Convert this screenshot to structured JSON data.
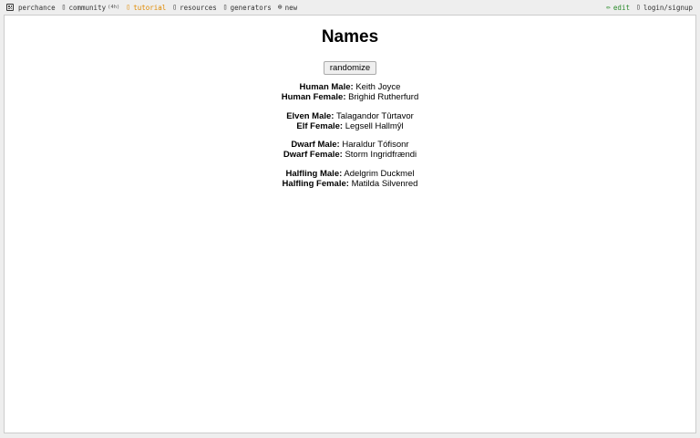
{
  "nav": {
    "brand": "perchance",
    "community": "community",
    "community_count": "(4h)",
    "tutorial": "tutorial",
    "resources": "resources",
    "generators": "generators",
    "new": "new",
    "edit": "edit",
    "login": "login/signup"
  },
  "page": {
    "title": "Names",
    "button": "randomize"
  },
  "groups": [
    [
      {
        "label": "Human Male:",
        "value": "Keith Joyce"
      },
      {
        "label": "Human Female:",
        "value": "Brighid Rutherfurd"
      }
    ],
    [
      {
        "label": "Elven Male:",
        "value": "Talagandor Tûrtavor"
      },
      {
        "label": "Elf Female:",
        "value": "Legsell Hallmŷl"
      }
    ],
    [
      {
        "label": "Dwarf Male:",
        "value": "Haraldur Tófisonr"
      },
      {
        "label": "Dwarf Female:",
        "value": "Storm Ingridfrændi"
      }
    ],
    [
      {
        "label": "Halfling Male:",
        "value": "Adelgrim Duckmel"
      },
      {
        "label": "Halfling Female:",
        "value": "Matilda Silvenred"
      }
    ]
  ],
  "colors": {
    "tutorial": "#e08a00",
    "edit": "#2a8a2a"
  },
  "icons": [
    "dice-icon",
    "chat-icon",
    "lightbulb-icon",
    "book-icon",
    "gear-icon",
    "plus-circle-icon",
    "pencil-icon",
    "user-icon"
  ]
}
